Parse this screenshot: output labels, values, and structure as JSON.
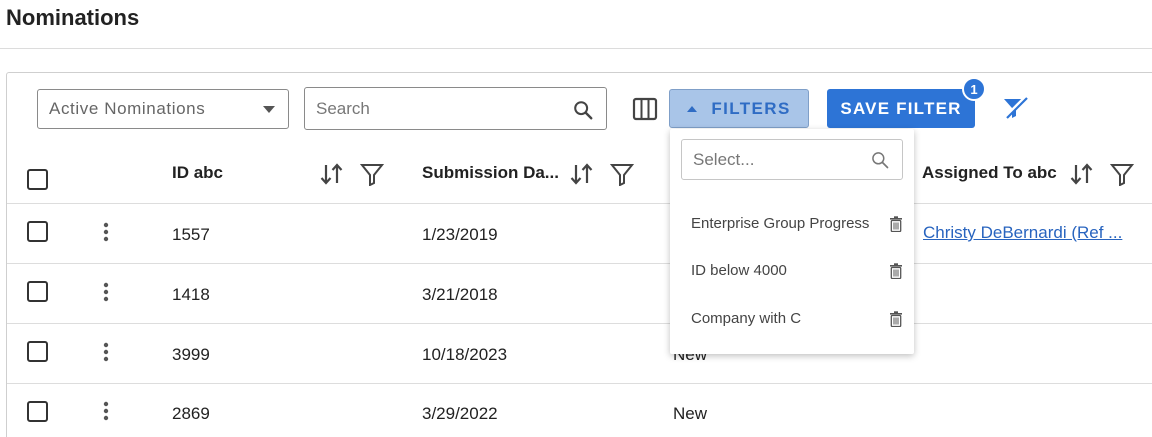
{
  "page": {
    "title": "Nominations"
  },
  "toolbar": {
    "view_select": "Active Nominations",
    "search_placeholder": "Search",
    "filters_label": "FILTERS",
    "save_filter_label": "SAVE FILTER",
    "saved_filter_count": "1",
    "accent_color": "#2d74d6",
    "icons": [
      "search-icon",
      "columns-icon",
      "caret-up-icon",
      "clear-filter-icon"
    ]
  },
  "table": {
    "columns": [
      {
        "label": "ID abc"
      },
      {
        "label": "Submission Da..."
      },
      {
        "label": ""
      },
      {
        "label": "Assigned To abc"
      }
    ],
    "rows": [
      {
        "id": "1557",
        "submission_date": "1/23/2019",
        "status": "",
        "assigned_to": "Christy DeBernardi (Ref ..."
      },
      {
        "id": "1418",
        "submission_date": "3/21/2018",
        "status": "",
        "assigned_to": ""
      },
      {
        "id": "3999",
        "submission_date": "10/18/2023",
        "status": "New",
        "assigned_to": ""
      },
      {
        "id": "2869",
        "submission_date": "3/29/2022",
        "status": "New",
        "assigned_to": ""
      }
    ]
  },
  "filters_dropdown": {
    "search_placeholder": "Select...",
    "items": [
      {
        "label": "Enterprise Group Progress"
      },
      {
        "label": "ID below 4000"
      },
      {
        "label": "Company with C"
      }
    ]
  }
}
